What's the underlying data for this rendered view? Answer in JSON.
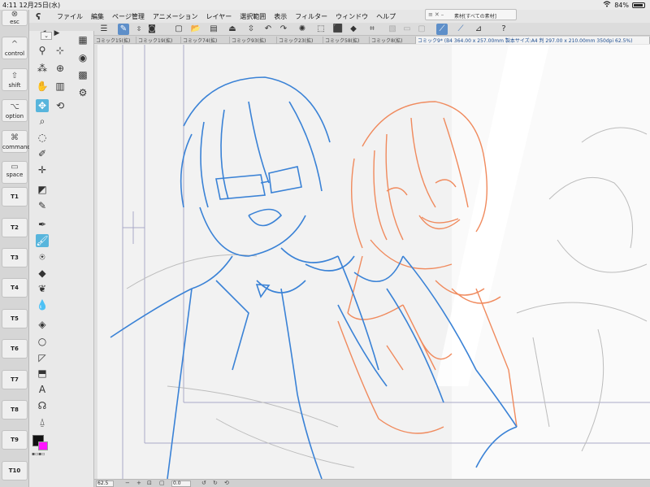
{
  "status": {
    "time": "4:11",
    "date": "12月25日(水)",
    "battery": "84%",
    "wifi_icon": "wifi-icon"
  },
  "keys": {
    "esc": "esc",
    "control": "control",
    "shift": "shift",
    "option": "option",
    "command": "command",
    "space": "space",
    "t": [
      "T1",
      "T2",
      "T3",
      "T4",
      "T5",
      "T6",
      "T7",
      "T8",
      "T9",
      "T10"
    ]
  },
  "menu": [
    "ファイル",
    "編集",
    "ページ管理",
    "アニメーション",
    "レイヤー",
    "選択範囲",
    "表示",
    "フィルター",
    "ウィンドウ",
    "ヘルプ"
  ],
  "material_window": {
    "title": "素材[すべての素材]"
  },
  "tabs": [
    "コミック15(拡)",
    "コミック19(拡)",
    "コミック74(拡)",
    "コミック93(拡)",
    "コミック23(拡)",
    "コミック58(拡)",
    "コミック8(拡)",
    "コミック9* (B4 364.00 x 257.00mm 製本サイズ:A4 判 297.00 x 210.00mm 350dpi 62.5%)"
  ],
  "bottom": {
    "zoom": "62.5",
    "rotation": "0.0"
  },
  "colors": {
    "main": "#111111",
    "sub": "#ff14ff",
    "accent": "#5e8fc9",
    "tool_selected": "#58b5dc",
    "sketch_blue": "#3a82d6",
    "sketch_orange": "#f08a5d"
  }
}
